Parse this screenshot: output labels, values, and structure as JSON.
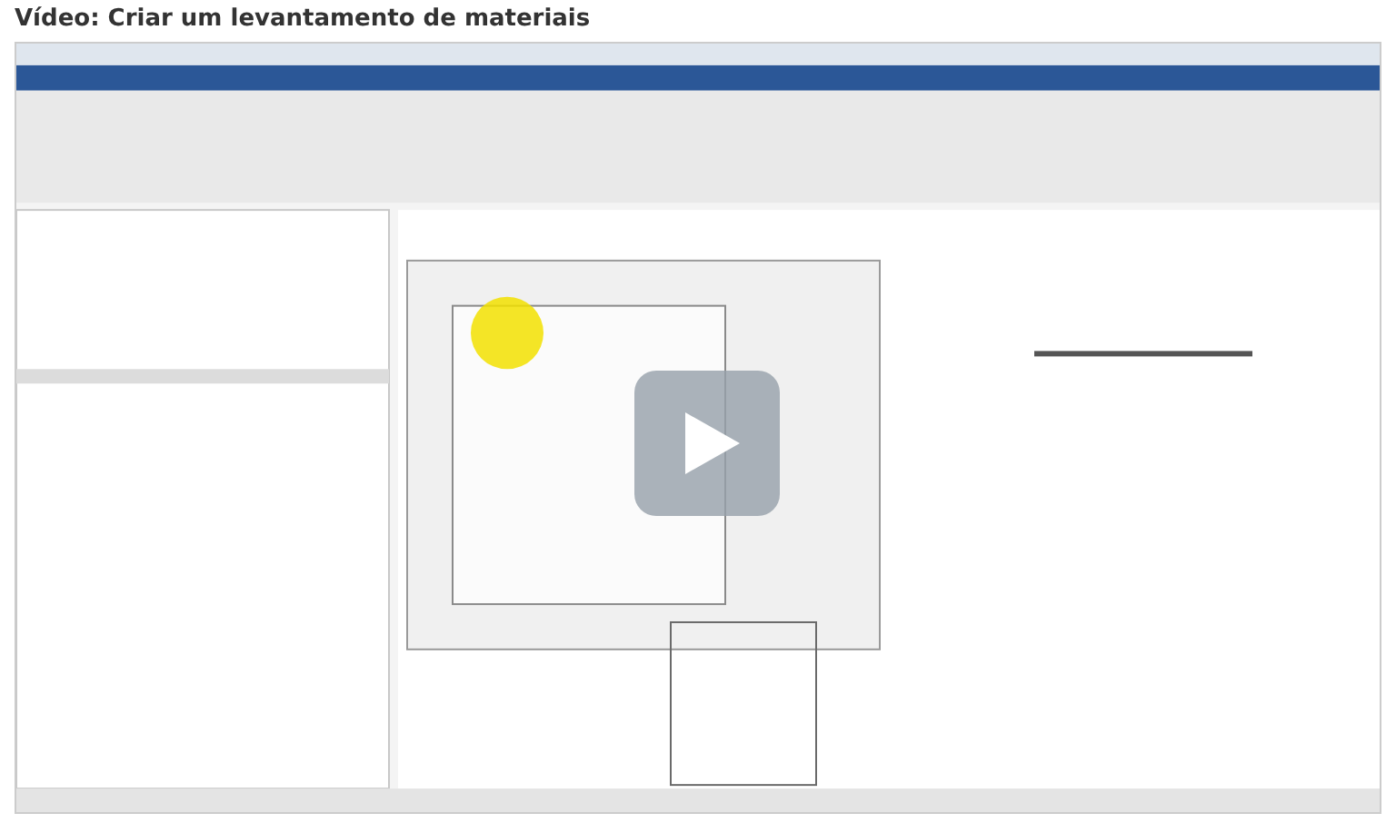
{
  "title": "Vídeo: Criar um levantamento de materiais",
  "video": {
    "kind": "picture",
    "play_button": true
  }
}
